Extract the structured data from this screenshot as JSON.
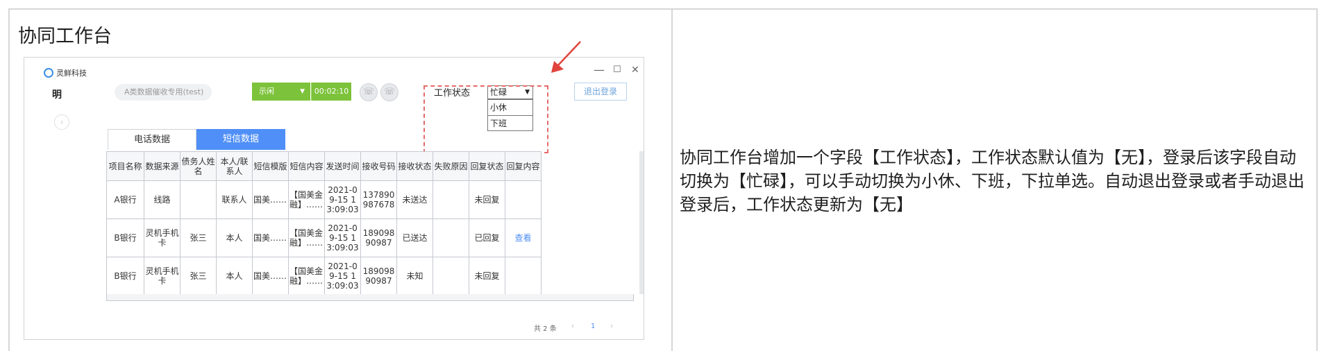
{
  "left_title": "协同工作台",
  "window": {
    "brand": "灵鲜科技",
    "controls": [
      "—",
      "☐",
      "✕"
    ],
    "user_name": "明",
    "project_pill": "A类数据催收专用(test)",
    "status_button": "示闲",
    "timer": "00:02:10",
    "call_icon": "☏",
    "hangup_icon": "☏",
    "work_status_label": "工作状态",
    "work_status_value": "忙碌",
    "work_status_options": [
      "小休",
      "下班"
    ],
    "logout_label": "退出登录",
    "back_icon": "‹",
    "tabs": [
      "电话数据",
      "短信数据"
    ]
  },
  "table": {
    "headers": [
      "项目名称",
      "数据来源",
      "债务人姓名",
      "本人/联系人",
      "短信模版",
      "短信内容",
      "发送时间",
      "接收号码",
      "接收状态",
      "失败原因",
      "回复状态",
      "回复内容"
    ],
    "rows": [
      [
        "A银行",
        "线路",
        "",
        "联系人",
        "国美……",
        "【国美金融】……",
        "2021-09-15 13:09:03",
        "137890987678",
        "未送达",
        "",
        "未回复",
        ""
      ],
      [
        "B银行",
        "灵机手机卡",
        "张三",
        "本人",
        "国美……",
        "【国美金融】……",
        "2021-09-15 13:09:03",
        "18909890987",
        "已送达",
        "",
        "已回复",
        "查看"
      ],
      [
        "B银行",
        "灵机手机卡",
        "张三",
        "本人",
        "国美……",
        "【国美金融】……",
        "2021-09-15 13:09:03",
        "18909890987",
        "未知",
        "",
        "未回复",
        ""
      ]
    ]
  },
  "pager": {
    "total": "共 2 条",
    "prev": "‹",
    "page": "1",
    "next": "›"
  },
  "description": "协同工作台增加一个字段【工作状态】，工作状态默认值为【无】，登录后该字段自动切换为【忙碌】，可以手动切换为小休、下班，下拉单选。自动退出登录或者手动退出登录后，工作状态更新为【无】",
  "colors": {
    "accent_green": "#7cc23a",
    "accent_blue": "#4f8ff7",
    "annotation_red": "#e46a6a"
  }
}
